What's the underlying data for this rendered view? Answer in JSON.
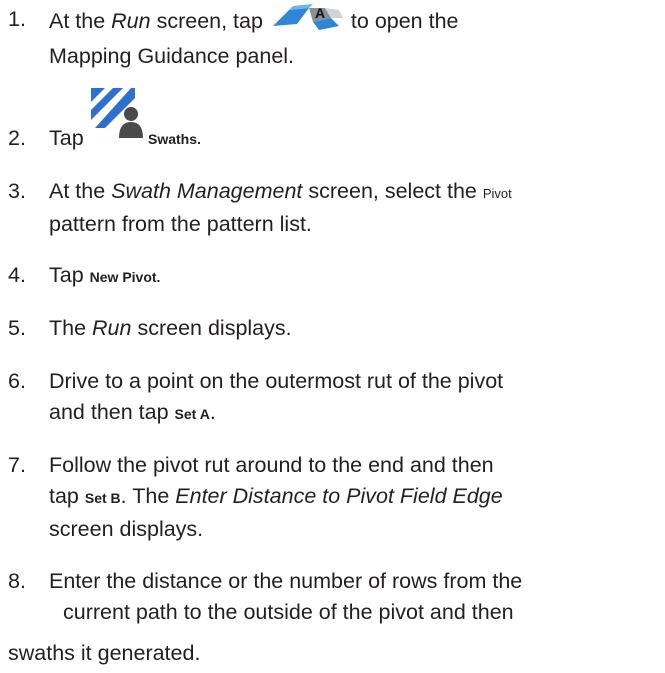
{
  "steps": [
    {
      "num": "1.",
      "pre": "At the ",
      "screen": "Run",
      "mid": " screen, tap ",
      "icon": "mapping-guidance-icon",
      "post": " to open the",
      "line2": "Mapping Guidance panel."
    },
    {
      "num": "2.",
      "pre": "Tap ",
      "icon": "swaths-icon",
      "label": "Swaths",
      "post": "."
    },
    {
      "num": "3.",
      "pre": "At the ",
      "screen": "Swath Management",
      "mid": " screen, select the ",
      "small": "Pivot",
      "line2": "pattern from the pattern list."
    },
    {
      "num": "4.",
      "pre": "Tap ",
      "label": "New Pivot",
      "post": "."
    },
    {
      "num": "5.",
      "pre": "The ",
      "screen": "Run",
      "post": " screen displays."
    },
    {
      "num": "6.",
      "line1": "Drive to a point on the outermost rut of the pivot",
      "pre": "and then tap ",
      "label": "Set A",
      "post": "."
    },
    {
      "num": "7.",
      "line1": "Follow the pivot rut around to the end and then",
      "pre": "tap ",
      "label": "Set B",
      "mid": ". The ",
      "screen": "Enter Distance to Pivot Field Edge",
      "line3": "screen displays."
    },
    {
      "num": "8.",
      "line1": "Enter the distance or the number of rows from the",
      "line2": "current path to the outside of the pivot and then"
    }
  ],
  "tail": "swaths it generated."
}
